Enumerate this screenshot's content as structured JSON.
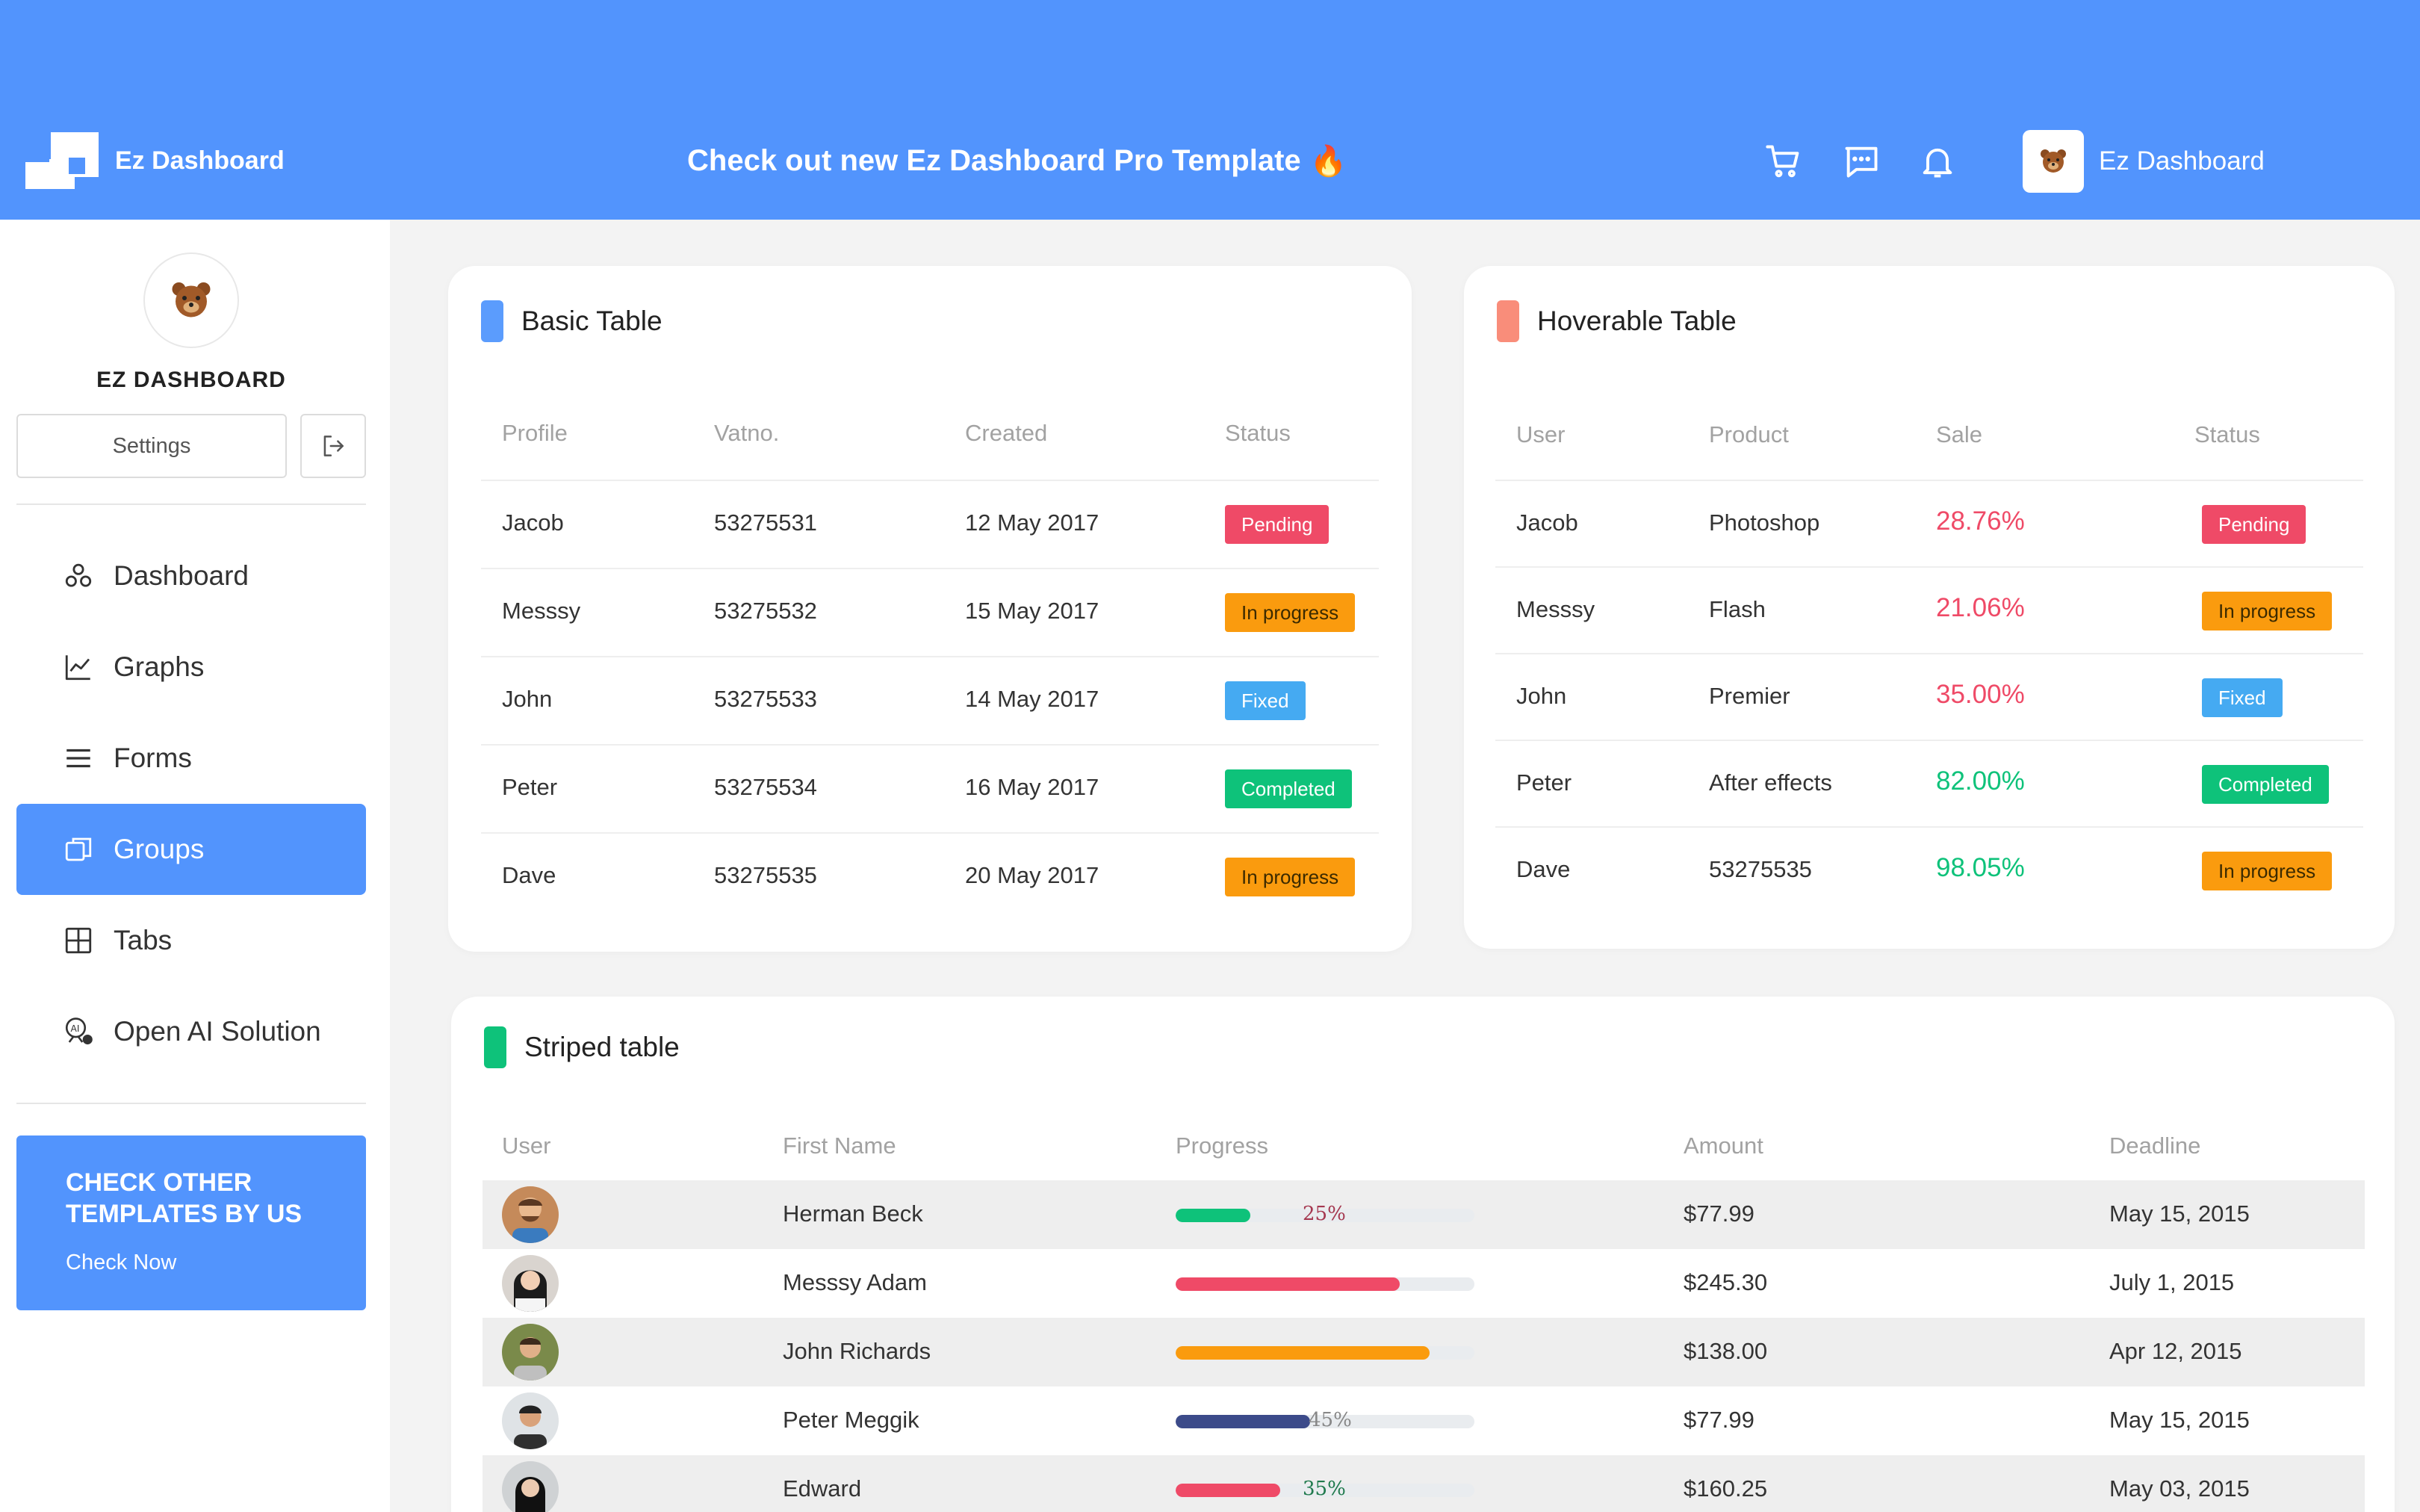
{
  "header": {
    "brand": "Ez Dashboard",
    "promo": "Check out new Ez Dashboard Pro Template",
    "promo_emoji": "🔥",
    "user_name": "Ez Dashboard",
    "icons": [
      "cart-icon",
      "chat-icon",
      "bell-icon"
    ]
  },
  "sidebar": {
    "title": "EZ DASHBOARD",
    "settings_label": "Settings",
    "items": [
      {
        "label": "Dashboard",
        "icon": "dashboard-icon"
      },
      {
        "label": "Graphs",
        "icon": "graph-icon"
      },
      {
        "label": "Forms",
        "icon": "list-icon"
      },
      {
        "label": "Groups",
        "icon": "groups-icon",
        "active": true
      },
      {
        "label": "Tabs",
        "icon": "tabs-icon"
      },
      {
        "label": "Open AI Solution",
        "icon": "ai-icon"
      }
    ],
    "cta": {
      "title": "CHECK OTHER TEMPLATES BY US",
      "link": "Check Now"
    }
  },
  "basic_table": {
    "title": "Basic Table",
    "columns": [
      "Profile",
      "Vatno.",
      "Created",
      "Status"
    ],
    "rows": [
      {
        "profile": "Jacob",
        "vatno": "53275531",
        "created": "12 May 2017",
        "status": "Pending"
      },
      {
        "profile": "Messsy",
        "vatno": "53275532",
        "created": "15 May 2017",
        "status": "In progress"
      },
      {
        "profile": "John",
        "vatno": "53275533",
        "created": "14 May 2017",
        "status": "Fixed"
      },
      {
        "profile": "Peter",
        "vatno": "53275534",
        "created": "16 May 2017",
        "status": "Completed"
      },
      {
        "profile": "Dave",
        "vatno": "53275535",
        "created": "20 May 2017",
        "status": "In progress"
      }
    ]
  },
  "hoverable_table": {
    "title": "Hoverable Table",
    "columns": [
      "User",
      "Product",
      "Sale",
      "Status"
    ],
    "rows": [
      {
        "user": "Jacob",
        "product": "Photoshop",
        "sale": "28.76%",
        "status": "Pending"
      },
      {
        "user": "Messsy",
        "product": "Flash",
        "sale": "21.06%",
        "status": "In progress"
      },
      {
        "user": "John",
        "product": "Premier",
        "sale": "35.00%",
        "status": "Fixed"
      },
      {
        "user": "Peter",
        "product": "After effects",
        "sale": "82.00%",
        "status": "Completed"
      },
      {
        "user": "Dave",
        "product": "53275535",
        "sale": "98.05%",
        "status": "In progress"
      }
    ]
  },
  "striped_table": {
    "title": "Striped table",
    "columns": [
      "User",
      "First Name",
      "Progress",
      "Amount",
      "Deadline"
    ],
    "rows": [
      {
        "name": "Herman Beck",
        "progress": 0.25,
        "progress_label": "25%",
        "color": "#0ec27a",
        "amount": "$77.99",
        "deadline": "May 15, 2015"
      },
      {
        "name": "Messsy Adam",
        "progress": 0.75,
        "progress_label": "",
        "color": "#ef4a67",
        "amount": "$245.30",
        "deadline": "July 1, 2015"
      },
      {
        "name": "John Richards",
        "progress": 0.85,
        "progress_label": "",
        "color": "#fa9b0e",
        "amount": "$138.00",
        "deadline": "Apr 12, 2015"
      },
      {
        "name": "Peter Meggik",
        "progress": 0.45,
        "progress_label": "45%",
        "color": "#3c4b8a",
        "amount": "$77.99",
        "deadline": "May 15, 2015"
      },
      {
        "name": "Edward",
        "progress": 0.35,
        "progress_label": "35%",
        "color": "#ef4a67",
        "amount": "$160.25",
        "deadline": "May 03, 2015"
      }
    ]
  },
  "colors": {
    "primary": "#5294fd",
    "pending": "#ef4a67",
    "in_progress": "#fa9b0e",
    "fixed": "#45aaf2",
    "completed": "#0ec27a",
    "sale_red": "#ef4a67",
    "sale_green": "#0ec27a"
  }
}
